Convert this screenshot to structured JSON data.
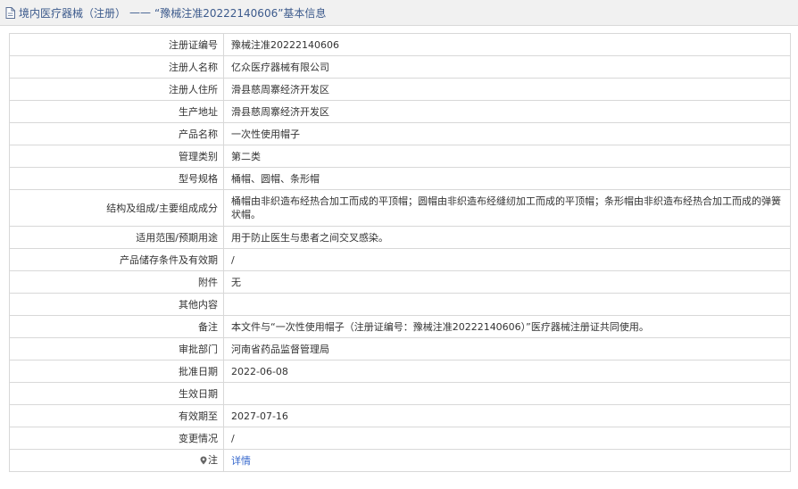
{
  "header": {
    "category": "境内医疗器械（注册）",
    "separator": "——",
    "subject": "“豫械注准20222140606”基本信息"
  },
  "rows": [
    {
      "label": "注册证编号",
      "value": "豫械注准20222140606"
    },
    {
      "label": "注册人名称",
      "value": "亿众医疗器械有限公司"
    },
    {
      "label": "注册人住所",
      "value": "滑县慈周寨经济开发区"
    },
    {
      "label": "生产地址",
      "value": "滑县慈周寨经济开发区"
    },
    {
      "label": "产品名称",
      "value": "一次性使用帽子"
    },
    {
      "label": "管理类别",
      "value": "第二类"
    },
    {
      "label": "型号规格",
      "value": "桶帽、圆帽、条形帽"
    },
    {
      "label": "结构及组成/主要组成成分",
      "value": "桶帽由非织造布经热合加工而成的平顶帽；圆帽由非织造布经缝纫加工而成的平顶帽；条形帽由非织造布经热合加工而成的弹簧状帽。"
    },
    {
      "label": "适用范围/预期用途",
      "value": "用于防止医生与患者之间交叉感染。"
    },
    {
      "label": "产品储存条件及有效期",
      "value": "/"
    },
    {
      "label": "附件",
      "value": "无"
    },
    {
      "label": "其他内容",
      "value": ""
    },
    {
      "label": "备注",
      "value": "本文件与“一次性使用帽子（注册证编号：豫械注准20222140606）”医疗器械注册证共同使用。"
    },
    {
      "label": "审批部门",
      "value": "河南省药品监督管理局"
    },
    {
      "label": "批准日期",
      "value": "2022-06-08"
    },
    {
      "label": "生效日期",
      "value": ""
    },
    {
      "label": "有效期至",
      "value": "2027-07-16"
    },
    {
      "label": "变更情况",
      "value": "/"
    }
  ],
  "note_row": {
    "label": "注",
    "link": "详情"
  },
  "colors": {
    "header_text": "#3c5a8c",
    "link": "#3366cc",
    "border": "#d8d8d8"
  }
}
